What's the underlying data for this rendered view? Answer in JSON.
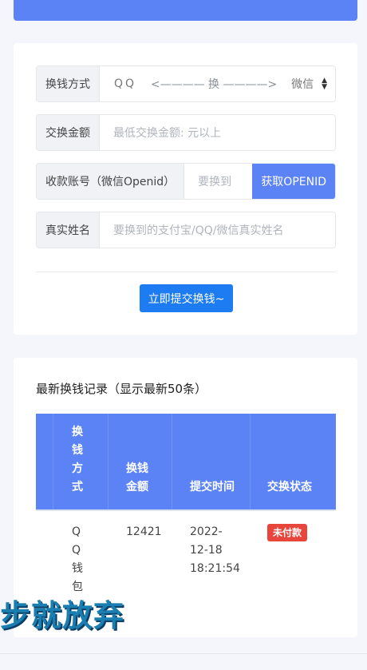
{
  "form": {
    "method": {
      "label": "换钱方式",
      "from": "QQ",
      "arrow": "<———— 换 ————>",
      "to": "微信"
    },
    "amount": {
      "label": "交换金额",
      "placeholder": "最低交换金额: 元以上"
    },
    "account": {
      "label": "收款账号（微信Openid）",
      "placeholder": "要换到",
      "button": "获取OPENID"
    },
    "name": {
      "label": "真实姓名",
      "placeholder": "要换到的支付宝/QQ/微信真实姓名"
    },
    "submit": "立即提交换钱~"
  },
  "records": {
    "title": "最新换钱记录（显示最新50条）",
    "headers": [
      "换钱方式",
      "换钱金额",
      "提交时间",
      "交换状态"
    ],
    "rows": [
      {
        "method": "QQ钱包",
        "amount": "12421",
        "time": "2022-12-18 18:21:54",
        "status": "未付款"
      }
    ]
  },
  "watermark": "步就放弃",
  "colors": {
    "accent": "#5b83f5",
    "submit": "#1d7cf2",
    "status_unpaid": "#e8453c"
  }
}
